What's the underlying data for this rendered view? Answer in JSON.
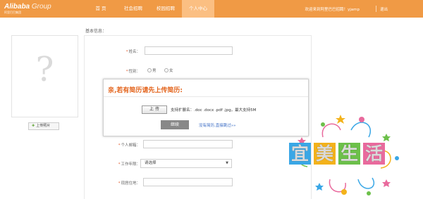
{
  "header": {
    "logo_brand": "Alibaba",
    "logo_group": "Group",
    "logo_sub": "阿里巴巴集团",
    "nav": [
      {
        "label": "首  页"
      },
      {
        "label": "社会招聘"
      },
      {
        "label": "校园招聘"
      },
      {
        "label": "个人中心"
      }
    ],
    "welcome": "欢迎来到阿里巴巴招聘！yjamp",
    "logout": "退出"
  },
  "left": {
    "upload_photo": "上传照片"
  },
  "form": {
    "section_title": "基本信息：",
    "name_label": "姓名：",
    "gender_label": "性别：",
    "gender_options": [
      "男",
      "女"
    ],
    "email_label": "个人邮箱：",
    "experience_label": "工作年限：",
    "experience_value": "请选择",
    "current_city_label": "现居住地："
  },
  "modal": {
    "title": "亲,若有简历请先上传简历:",
    "upload_button": "上 传",
    "support_text": "支持扩展名：.doc .docx .pdf .jpg，最大支持5M",
    "continue_button": "继续",
    "skip_link": "没有简历,直接跳过»»"
  },
  "watermark": {
    "chars": [
      "宜",
      "美",
      "生",
      "活"
    ],
    "colors": [
      "#3aa7e6",
      "#f3b21b",
      "#6cc04a",
      "#e96a9d"
    ]
  },
  "colors": {
    "header_bg": "#f09a45",
    "nav_active": "#fbbf82",
    "accent_orange": "#e3641c",
    "link_blue": "#3a6bc4"
  }
}
